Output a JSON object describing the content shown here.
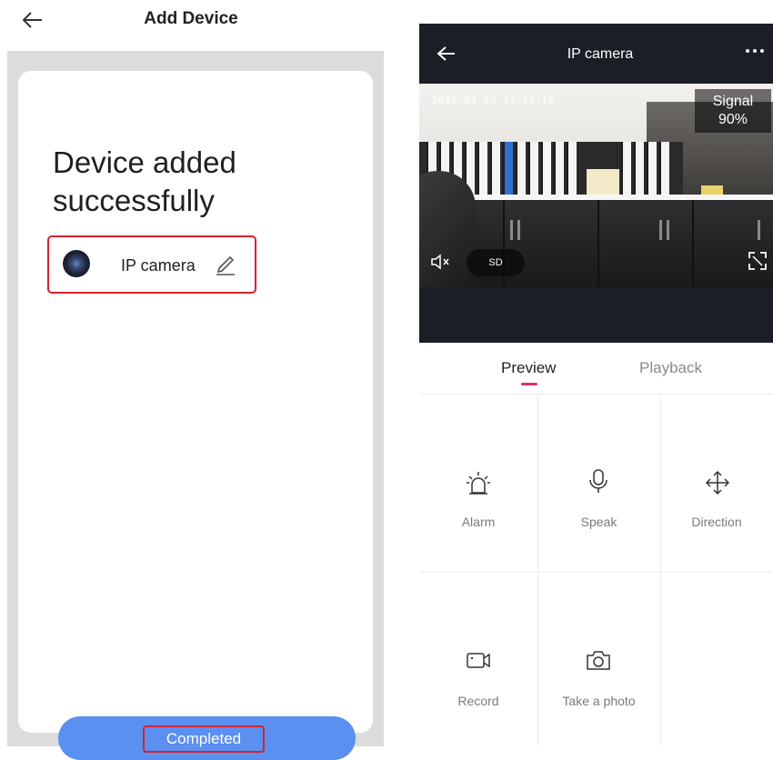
{
  "left": {
    "header_title": "Add Device",
    "headline": "Device added successfully",
    "device": {
      "name": "IP camera"
    },
    "completed_button": "Completed"
  },
  "right": {
    "title": "IP camera",
    "video": {
      "timestamp": "2019-03-23 13:11:18",
      "signal_label": "Signal",
      "signal_value": "90%",
      "quality": "SD"
    },
    "tabs": [
      {
        "label": "Preview",
        "active": true
      },
      {
        "label": "Playback",
        "active": false
      }
    ],
    "controls": [
      {
        "label": "Alarm",
        "icon": "alarm-icon"
      },
      {
        "label": "Speak",
        "icon": "microphone-icon"
      },
      {
        "label": "Direction",
        "icon": "direction-arrows-icon"
      },
      {
        "label": "Record",
        "icon": "video-record-icon"
      },
      {
        "label": "Take a photo",
        "icon": "camera-icon"
      }
    ]
  },
  "colors": {
    "primary_button": "#5b8ff0",
    "highlight_border": "#d3222f",
    "tab_accent": "#e0306b",
    "top_bar": "#1c1e26"
  }
}
